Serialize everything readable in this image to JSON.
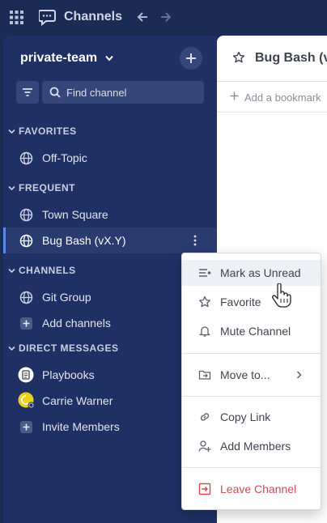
{
  "topbar": {
    "title": "Channels"
  },
  "sidebar": {
    "team_name": "private-team",
    "search_placeholder": "Find channel",
    "sections": {
      "favorites": "FAVORITES",
      "frequent": "FREQUENT",
      "channels": "CHANNELS",
      "direct": "DIRECT MESSAGES"
    },
    "favorites": [
      {
        "label": "Off-Topic",
        "icon": "globe-icon"
      }
    ],
    "frequent": [
      {
        "label": "Town Square",
        "icon": "globe-icon"
      },
      {
        "label": "Bug Bash (vX.Y)",
        "icon": "globe-icon",
        "active": true
      }
    ],
    "channels": [
      {
        "label": "Git Group",
        "icon": "globe-icon"
      },
      {
        "label": "Add channels",
        "icon": "plus-box-icon"
      }
    ],
    "direct": [
      {
        "label": "Playbooks",
        "icon": "playbooks-avatar"
      },
      {
        "label": "Carrie Warner",
        "icon": "user-avatar"
      },
      {
        "label": "Invite Members",
        "icon": "plus-box-icon"
      }
    ]
  },
  "main": {
    "channel_name": "Bug Bash (v",
    "add_bookmark": "Add a bookmark"
  },
  "menu": {
    "items": {
      "mark_unread": "Mark as Unread",
      "favorite": "Favorite",
      "mute": "Mute Channel",
      "move_to": "Move to...",
      "copy_link": "Copy Link",
      "add_members": "Add Members",
      "leave": "Leave Channel"
    }
  },
  "colors": {
    "sidebar_bg": "#1f3164",
    "topbar_bg": "#1b2c54",
    "active_indicator": "#5d89ea",
    "danger": "#d24b4e"
  }
}
